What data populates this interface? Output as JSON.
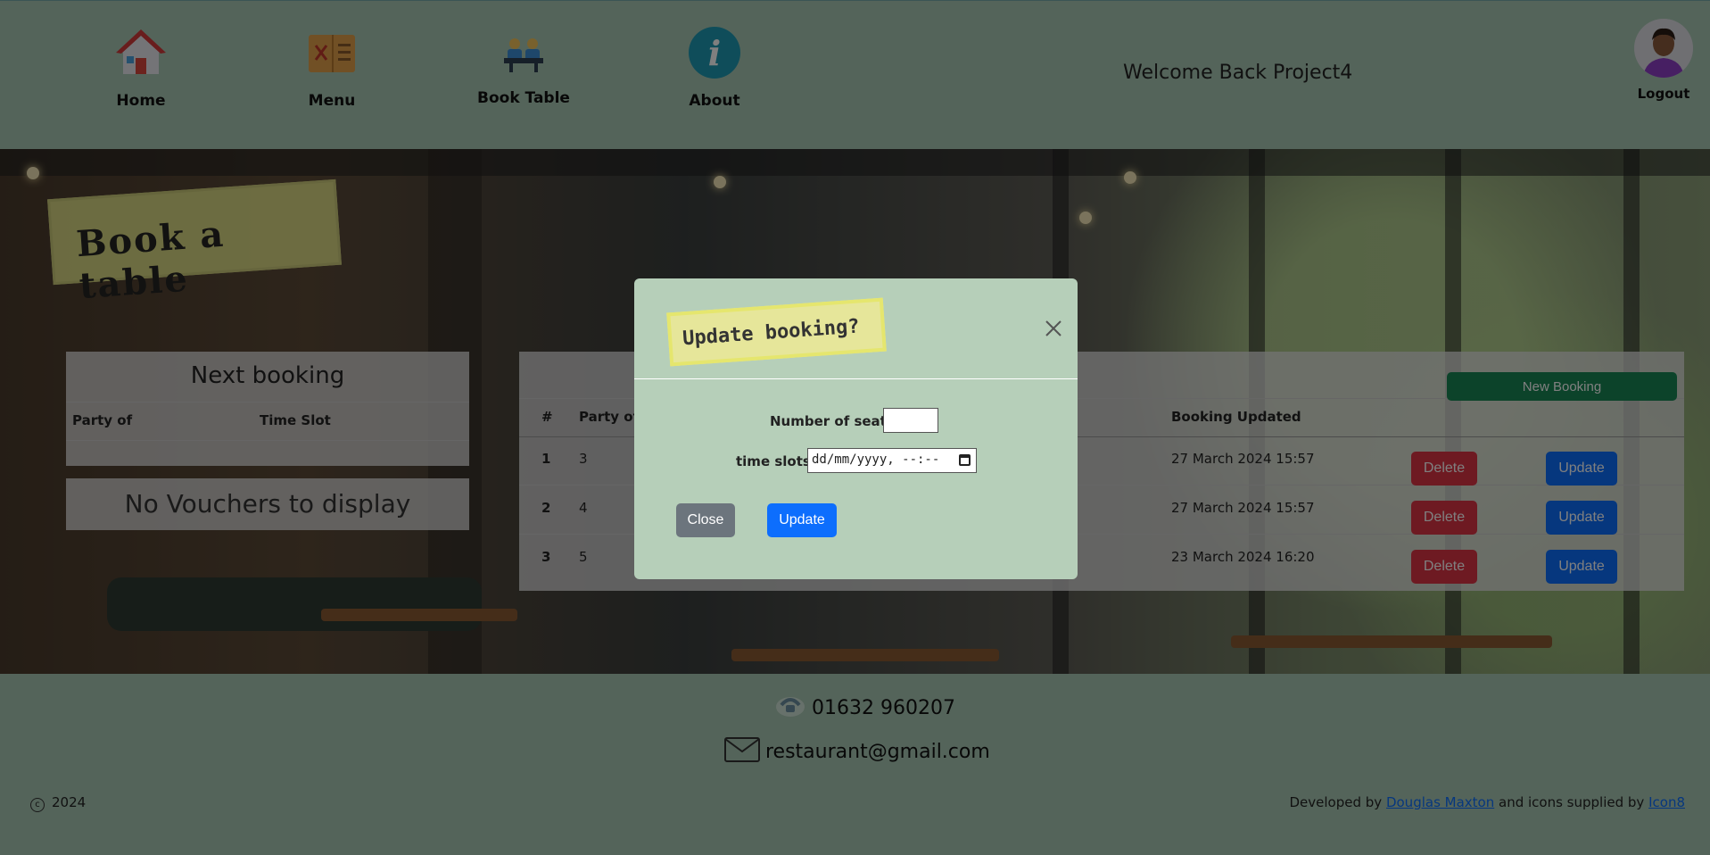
{
  "nav": {
    "items": [
      {
        "label": "Home",
        "icon": "home-icon"
      },
      {
        "label": "Menu",
        "icon": "menu-book-icon"
      },
      {
        "label": "Book Table",
        "icon": "booking-table-icon"
      },
      {
        "label": "About",
        "icon": "info-icon"
      }
    ],
    "welcome": "Welcome Back Project4",
    "logout": "Logout"
  },
  "page": {
    "heading": "Book a table",
    "next_booking": {
      "title": "Next booking",
      "columns": [
        "Party of",
        "Time Slot"
      ]
    },
    "vouchers_empty": "No Vouchers to display",
    "new_booking_label": "New Booking",
    "table": {
      "columns": [
        "#",
        "Party of",
        "Booking Updated"
      ],
      "rows": [
        {
          "num": "1",
          "party": "3",
          "updated": "27 March 2024 15:57"
        },
        {
          "num": "2",
          "party": "4",
          "updated": "27 March 2024 15:57"
        },
        {
          "num": "3",
          "party": "5",
          "updated": "23 March 2024 16:20"
        }
      ],
      "delete_label": "Delete",
      "update_label": "Update"
    }
  },
  "modal": {
    "title": "Update booking?",
    "seats_label": "Number of seats:",
    "seats_value": "",
    "time_label": "time slots:",
    "time_placeholder": "dd/mm/yyyy, --:--",
    "close_label": "Close",
    "update_label": "Update"
  },
  "footer": {
    "phone": "01632 960207",
    "email": "restaurant@gmail.com",
    "year": "2024",
    "credit_prefix": "Developed by",
    "developer": "Douglas Maxton",
    "credit_middle": "and icons supplied by",
    "icon_provider": "Icon8"
  },
  "colors": {
    "background": "#a9c8b4",
    "modal_bg": "#b6cfb9",
    "primary": "#0d6efd",
    "danger": "#dc3545",
    "success": "#198754",
    "secondary": "#6c757d",
    "sign_yellow": "#e5e58a"
  }
}
